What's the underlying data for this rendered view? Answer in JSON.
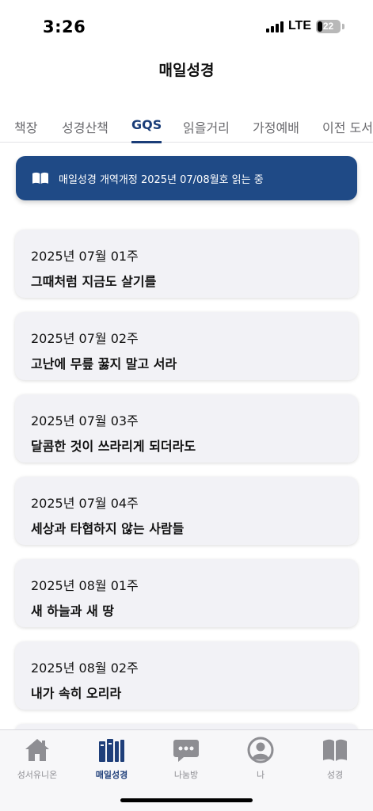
{
  "status_bar": {
    "time": "3:26",
    "network": "LTE",
    "battery": "22",
    "battery_level": 0.22
  },
  "header": {
    "title": "매일성경"
  },
  "tabs": [
    {
      "label": "책장",
      "active": false
    },
    {
      "label": "성경산책",
      "active": false
    },
    {
      "label": "GQS",
      "active": true
    },
    {
      "label": "읽을거리",
      "active": false
    },
    {
      "label": "가정예배",
      "active": false
    },
    {
      "label": "이전 도서",
      "active": false
    }
  ],
  "banner": {
    "icon": "open-book-icon",
    "text": "매일성경 개역개정  2025년 07/08월호 읽는 중"
  },
  "weeks": [
    {
      "week": "2025년 07월 01주",
      "title": "그때처럼 지금도 살기를"
    },
    {
      "week": "2025년 07월 02주",
      "title": "고난에 무릎 꿇지 말고 서라"
    },
    {
      "week": "2025년 07월 03주",
      "title": "달콤한 것이 쓰라리게 되더라도"
    },
    {
      "week": "2025년 07월 04주",
      "title": "세상과 타협하지 않는 사람들"
    },
    {
      "week": "2025년 08월 01주",
      "title": "새 하늘과 새 땅"
    },
    {
      "week": "2025년 08월 02주",
      "title": "내가 속히 오리라"
    }
  ],
  "tabbar": [
    {
      "label": "성서유니온",
      "icon": "home-icon",
      "active": false
    },
    {
      "label": "매일성경",
      "icon": "books-icon",
      "active": true
    },
    {
      "label": "나눔방",
      "icon": "chat-bubble-icon",
      "active": false
    },
    {
      "label": "나",
      "icon": "person-icon",
      "active": false
    },
    {
      "label": "성경",
      "icon": "bible-book-icon",
      "active": false
    }
  ],
  "colors": {
    "accent": "#1f4a86",
    "tab_active": "#1a3d78",
    "card_bg": "#f2f2f6",
    "tab_inactive": "#8e8e93"
  }
}
